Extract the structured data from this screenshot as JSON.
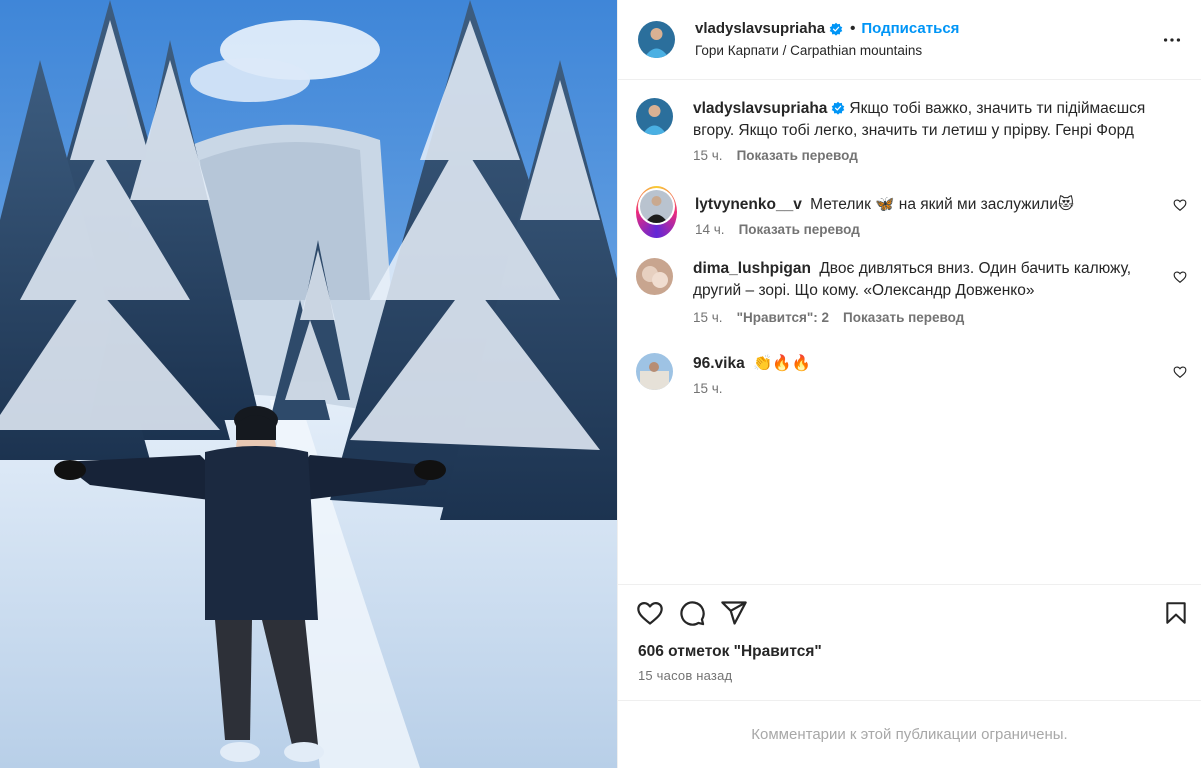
{
  "post": {
    "username": "vladyslavsupriaha",
    "dot": "•",
    "follow_label": "Подписаться",
    "location": "Гори Карпати / Carpathian mountains"
  },
  "caption": {
    "username": "vladyslavsupriaha",
    "text": "Якщо тобі важко, значить ти підіймаєшся вгору. Якщо тобі легко, значить ти летиш у прірву. Генрі Форд",
    "time": "15 ч.",
    "translate": "Показать перевод"
  },
  "comments": [
    {
      "username": "lytvynenko__v",
      "text": "Метелик 🦋 на який ми заслужили😻",
      "time": "14 ч.",
      "translate": "Показать перевод"
    },
    {
      "username": "dima_lushpigan",
      "text": "Двоє дивляться вниз. Один бачить калюжу, другий – зорі. Що кому. «Олександр Довженко»",
      "time": "15 ч.",
      "likes": "\"Нравится\": 2",
      "translate": "Показать перевод"
    },
    {
      "username": "96.vika",
      "text": "👏🔥🔥",
      "time": "15 ч."
    }
  ],
  "likes_count": "606 отметок \"Нравится\"",
  "posted_ago": "15 часов назад",
  "comments_restricted": "Комментарии к этой публикации ограничены.",
  "icons": [
    "verified-badge-icon",
    "more-icon",
    "heart-icon",
    "comment-icon",
    "share-icon",
    "bookmark-icon"
  ],
  "colors": {
    "accent": "#0095f6",
    "text": "#262626",
    "secondary": "#737373",
    "muted": "#a8a8a8"
  }
}
